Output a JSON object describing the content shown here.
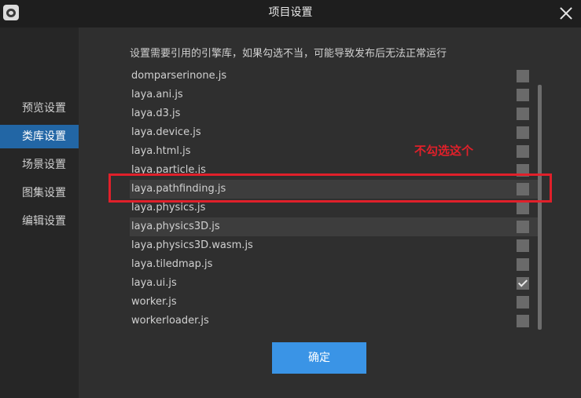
{
  "window": {
    "title": "项目设置"
  },
  "sidebar": {
    "items": [
      {
        "label": "预览设置",
        "active": false
      },
      {
        "label": "类库设置",
        "active": true
      },
      {
        "label": "场景设置",
        "active": false
      },
      {
        "label": "图集设置",
        "active": false
      },
      {
        "label": "编辑设置",
        "active": false
      }
    ]
  },
  "main": {
    "description": "设置需要引用的引擎库，如果勾选不当，可能导致发布后无法正常运行",
    "libraries": [
      {
        "name": "domparserinone.js",
        "checked": false
      },
      {
        "name": "laya.ani.js",
        "checked": false
      },
      {
        "name": "laya.d3.js",
        "checked": false
      },
      {
        "name": "laya.device.js",
        "checked": false
      },
      {
        "name": "laya.html.js",
        "checked": false
      },
      {
        "name": "laya.particle.js",
        "checked": false
      },
      {
        "name": "laya.pathfinding.js",
        "checked": false
      },
      {
        "name": "laya.physics.js",
        "checked": false
      },
      {
        "name": "laya.physics3D.js",
        "checked": false
      },
      {
        "name": "laya.physics3D.wasm.js",
        "checked": false
      },
      {
        "name": "laya.tiledmap.js",
        "checked": false
      },
      {
        "name": "laya.ui.js",
        "checked": true
      },
      {
        "name": "worker.js",
        "checked": false
      },
      {
        "name": "workerloader.js",
        "checked": false
      }
    ],
    "confirm_label": "确定"
  },
  "annotation": {
    "text": "不勾选这个",
    "color": "#e0202a"
  },
  "colors": {
    "accent": "#2266a5",
    "button": "#3a94e6"
  }
}
